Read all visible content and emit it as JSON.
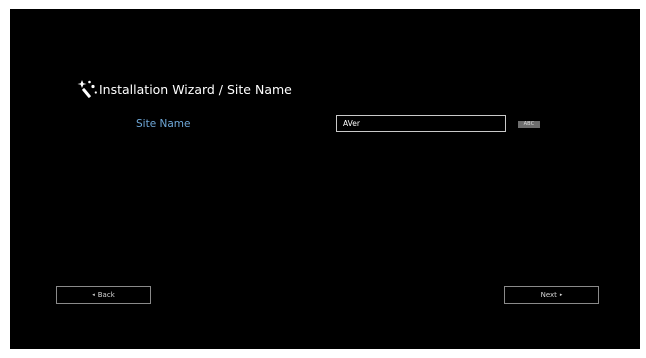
{
  "header": {
    "title": "Installation Wizard / Site Name",
    "icon": "magic-wand-icon"
  },
  "form": {
    "site_name_label": "Site Name",
    "site_name_value": "AVer",
    "input_mode_badge": "ABC"
  },
  "nav": {
    "back_label": "Back",
    "back_arrow": "◂",
    "next_label": "Next",
    "next_arrow": "▸"
  },
  "colors": {
    "background": "#000000",
    "label_blue": "#6fa8d8",
    "text_white": "#ffffff",
    "button_border": "#8a8a8a",
    "badge_gray": "#6e6e6e"
  }
}
